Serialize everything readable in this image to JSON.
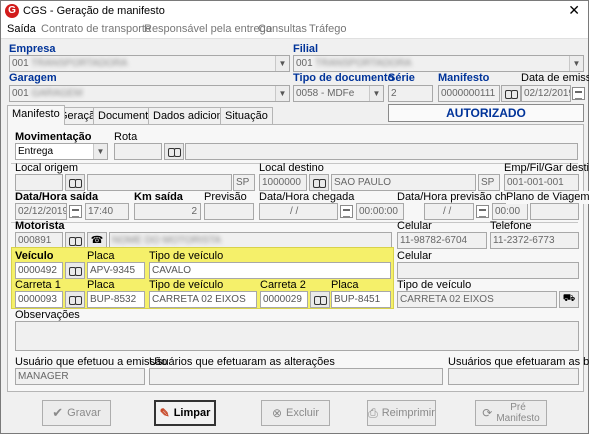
{
  "window": {
    "title": "CGS - Geração de manifesto"
  },
  "menu": [
    "Saída",
    "Contrato de transporte",
    "Responsável pela entrega",
    "Consultas",
    "Tráfego"
  ],
  "header": {
    "empresa_label": "Empresa",
    "empresa_value": "001",
    "filial_label": "Filial",
    "filial_value": "001",
    "garagem_label": "Garagem",
    "garagem_value": "001",
    "tipodoc_label": "Tipo de documento",
    "tipodoc_value": "0058 - MDFe",
    "serie_label": "Série",
    "serie_value": "2",
    "manifesto_label": "Manifesto",
    "manifesto_value": "0000000111",
    "dataemissao_label": "Data de emissão",
    "dataemissao_value": "02/12/2019"
  },
  "tabs": [
    "Manifesto",
    "Geração",
    "Documentos",
    "Dados adicionais",
    "Situação"
  ],
  "status": "AUTORIZADO",
  "form": {
    "movimentacao_label": "Movimentação",
    "movimentacao_value": "Entrega",
    "rota_label": "Rota",
    "local_origem_label": "Local origem",
    "local_origem_uf": "SP",
    "local_destino_label": "Local destino",
    "local_destino_code": "1000000",
    "local_destino_name": "SAO PAULO",
    "local_destino_uf": "SP",
    "empfil_label": "Emp/Fil/Gar destino",
    "empfil_value": "001-001-001",
    "data_saida_label": "Data/Hora saída",
    "data_saida_value": "02/12/2019",
    "hora_saida_value": "17:40",
    "km_saida_label": "Km saída",
    "km_saida_value": "2",
    "previsao_label": "Previsão",
    "data_chegada_label": "Data/Hora chegada",
    "data_chegada_value": "/ /",
    "hora_chegada_value": "00:00:00",
    "data_prev_chegada_label": "Data/Hora previsão chegada",
    "data_prev_chegada_value": "/ /",
    "hora_prev_chegada_value": "00:00",
    "plano_label": "Plano de Viagem",
    "motorista_label": "Motorista",
    "motorista_value": "000891",
    "celular_label": "Celular",
    "celular_value": "11-98782-6704",
    "telefone_label": "Telefone",
    "telefone_value": "11-2372-6773",
    "veiculo_label": "Veículo",
    "veiculo_value": "0000492",
    "placa_label": "Placa",
    "placa_value": "APV-9345",
    "tipo_veiculo_label": "Tipo de veículo",
    "tipo_veiculo_value": "CAVALO",
    "celular2_label": "Celular",
    "carreta1_label": "Carreta 1",
    "carreta1_value": "0000093",
    "placa2_label": "Placa",
    "placa2_value": "BUP-8532",
    "tipo_veiculo2_label": "Tipo de veículo",
    "tipo_veiculo2_value": "CARRETA 02 EIXOS",
    "carreta2_label": "Carreta 2",
    "carreta2_value": "0000029",
    "placa3_label": "Placa",
    "placa3_value": "BUP-8451",
    "tipo_veiculo3_label": "Tipo de veículo",
    "tipo_veiculo3_value": "CARRETA 02 EIXOS",
    "observacoes_label": "Observações",
    "usuario_emissao_label": "Usuário que efetuou a emissão",
    "usuario_emissao_value": "MANAGER",
    "usuarios_alteracoes_label": "Usuários que efetuaram as alterações",
    "usuarios_baixas_label": "Usuários que efetuaram as baixas"
  },
  "buttons": {
    "gravar": "Gravar",
    "limpar": "Limpar",
    "excluir": "Excluir",
    "reimprimir": "Reimprimir",
    "pre_manifesto_1": "Pré",
    "pre_manifesto_2": "Manifesto"
  },
  "colors": {
    "highlight": "#f5f06a",
    "label_blue": "#003399",
    "status_blue": "#003399"
  }
}
